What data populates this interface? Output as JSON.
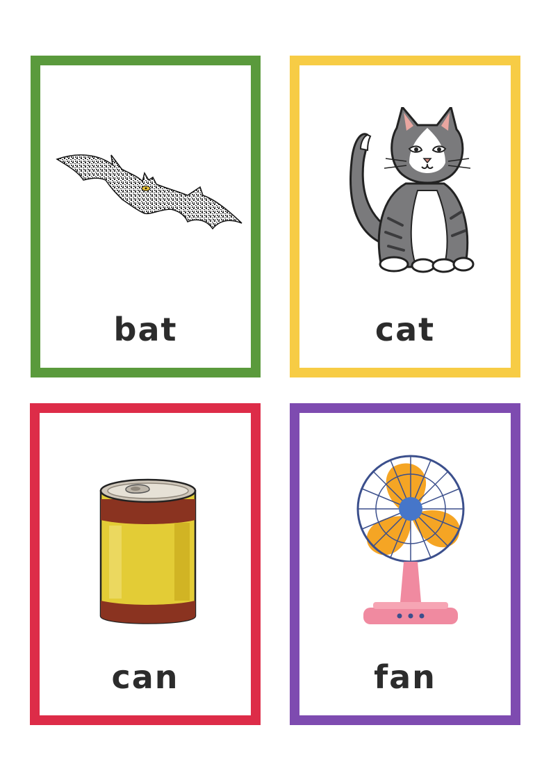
{
  "cards": [
    {
      "word": "bat",
      "picture": "bat-icon",
      "border_color": "#5a9a3c"
    },
    {
      "word": "cat",
      "picture": "cat-icon",
      "border_color": "#f7cc45"
    },
    {
      "word": "can",
      "picture": "can-icon",
      "border_color": "#dd2c48"
    },
    {
      "word": "fan",
      "picture": "fan-icon",
      "border_color": "#7e4bb0"
    }
  ]
}
